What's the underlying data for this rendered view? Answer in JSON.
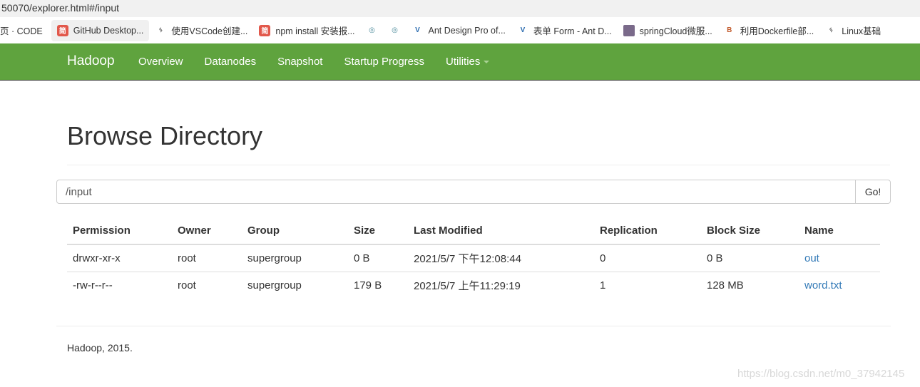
{
  "browser": {
    "url": "50070/explorer.html#/input",
    "bookmarks": [
      {
        "label": "页 · CODE",
        "icon": "none"
      },
      {
        "label": "GitHub Desktop...",
        "icon": "jian-icon"
      },
      {
        "label": "使用VSCode创建...",
        "icon": "curl-icon"
      },
      {
        "label": "npm install 安装报...",
        "icon": "jian-icon"
      },
      {
        "label": "",
        "icon": "swirl-icon"
      },
      {
        "label": "",
        "icon": "swirl-icon"
      },
      {
        "label": "Ant Design Pro of...",
        "icon": "v-icon"
      },
      {
        "label": "表单 Form - Ant D...",
        "icon": "v-icon"
      },
      {
        "label": "springCloud微服...",
        "icon": "photo-icon"
      },
      {
        "label": "利用Dockerfile部...",
        "icon": "b-icon"
      },
      {
        "label": "Linux基础",
        "icon": "curl-icon"
      }
    ],
    "icon_glyphs": {
      "jian": "简",
      "curl": "ᛃ",
      "swirl": "◎",
      "v": "V",
      "b": "B"
    }
  },
  "navbar": {
    "brand": "Hadoop",
    "links": [
      {
        "label": "Overview"
      },
      {
        "label": "Datanodes"
      },
      {
        "label": "Snapshot"
      },
      {
        "label": "Startup Progress"
      },
      {
        "label": "Utilities",
        "dropdown": true
      }
    ],
    "color": "#5fa33e"
  },
  "page": {
    "title": "Browse Directory",
    "path_value": "/input",
    "go_label": "Go!"
  },
  "table": {
    "headers": [
      "Permission",
      "Owner",
      "Group",
      "Size",
      "Last Modified",
      "Replication",
      "Block Size",
      "Name"
    ],
    "rows": [
      [
        "drwxr-xr-x",
        "root",
        "supergroup",
        "0 B",
        "2021/5/7 下午12:08:44",
        "0",
        "0 B",
        "out"
      ],
      [
        "-rw-r--r--",
        "root",
        "supergroup",
        "179 B",
        "2021/5/7 上午11:29:19",
        "1",
        "128 MB",
        "word.txt"
      ]
    ],
    "link_color": "#337ab7"
  },
  "footer": {
    "text": "Hadoop, 2015."
  },
  "watermark": "https://blog.csdn.net/m0_37942145"
}
